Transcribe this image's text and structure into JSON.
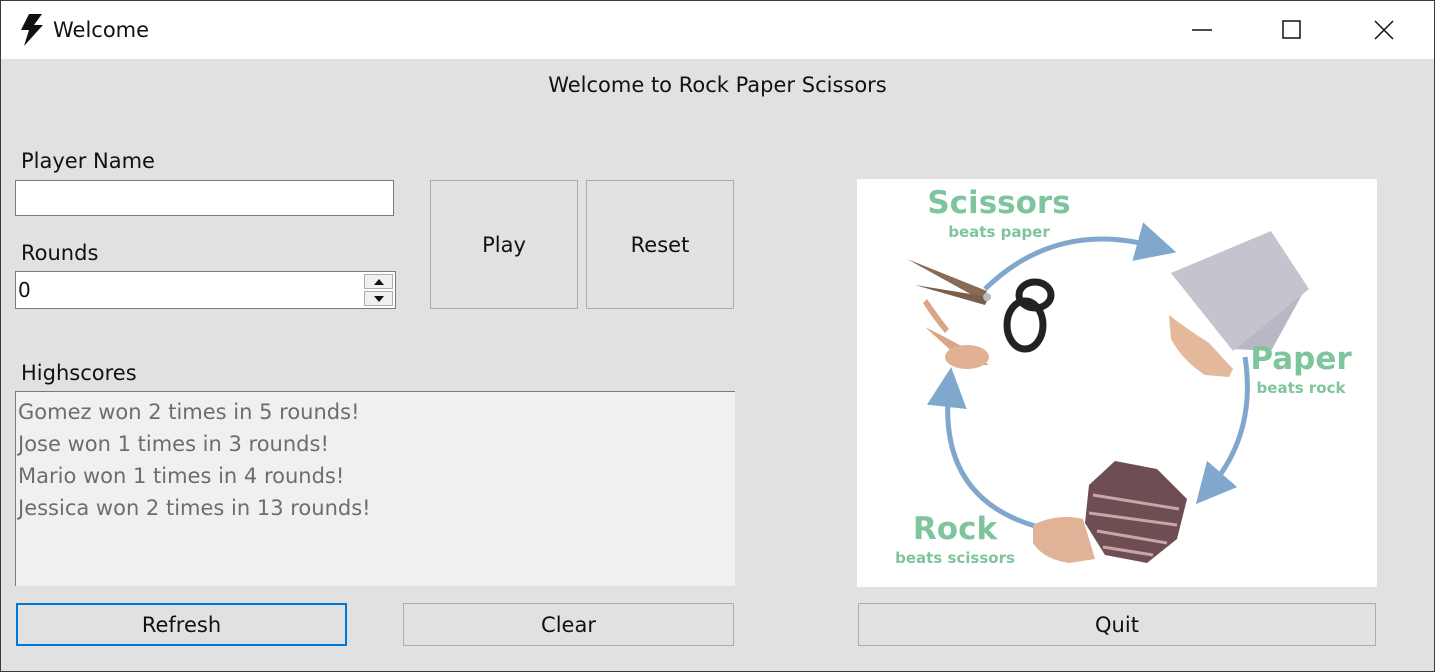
{
  "window": {
    "title": "Welcome",
    "icon": "lightning-bolt-icon"
  },
  "titlebar_buttons": [
    "minimize-icon",
    "maximize-icon",
    "close-icon"
  ],
  "heading": "Welcome to Rock Paper Scissors",
  "player_name": {
    "label": "Player Name",
    "value": ""
  },
  "rounds": {
    "label": "Rounds",
    "value": "0"
  },
  "buttons": {
    "play": "Play",
    "reset": "Reset",
    "refresh": "Refresh",
    "clear": "Clear",
    "quit": "Quit"
  },
  "highscores": {
    "label": "Highscores",
    "items": [
      "Gomez won 2 times in 5 rounds!",
      "Jose won 1 times in 3 rounds!",
      "Mario won 1 times in 4 rounds!",
      "Jessica won 2 times in 13 rounds!"
    ]
  },
  "diagram": {
    "scissors": {
      "title": "Scissors",
      "subtitle": "beats paper"
    },
    "paper": {
      "title": "Paper",
      "subtitle": "beats rock"
    },
    "rock": {
      "title": "Rock",
      "subtitle": "beats scissors"
    },
    "colors": {
      "text": "#7ec49c",
      "arrow": "#7fa8cc"
    }
  }
}
